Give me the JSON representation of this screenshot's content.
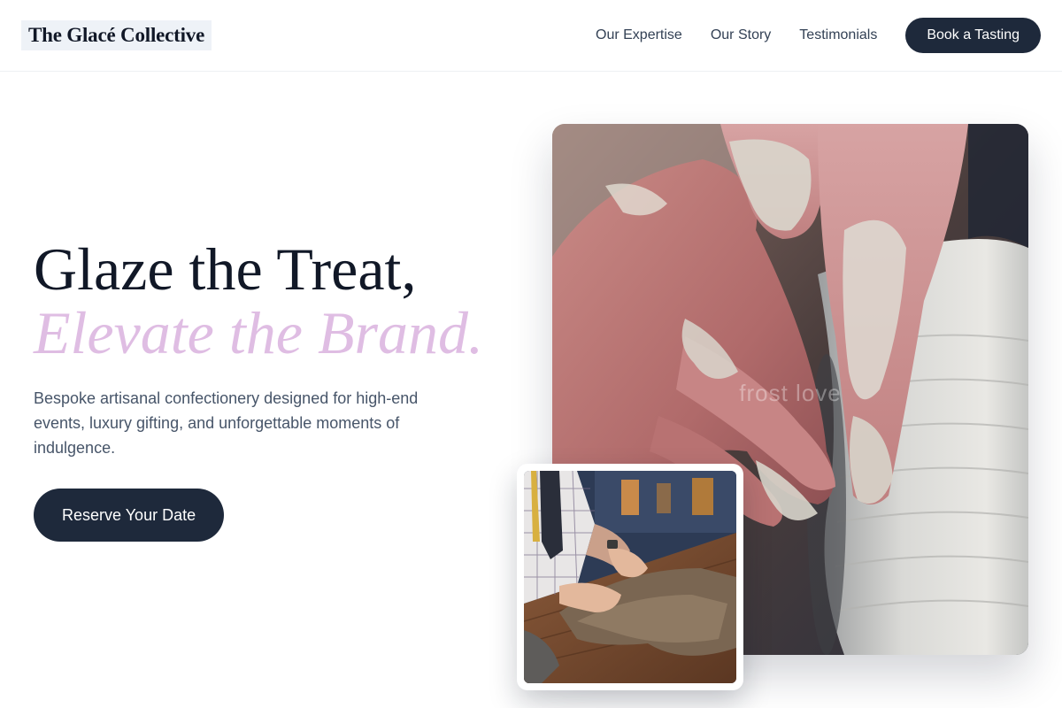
{
  "header": {
    "logo": "The Glacé Collective",
    "nav": {
      "expertise": "Our Expertise",
      "story": "Our Story",
      "testimonials": "Testimonials",
      "cta": "Book a Tasting"
    }
  },
  "hero": {
    "headline_line1": "Glaze the Treat,",
    "headline_line2": "Elevate the Brand.",
    "subtext": "Bespoke artisanal confectionery designed for high-end events, luxury gifting, and unforgettable moments of indulgence.",
    "cta": "Reserve Your Date"
  },
  "images": {
    "main_watermark": "frost love"
  },
  "colors": {
    "brand_dark": "#1e293b",
    "accent_lilac": "#dfbde3",
    "body_text": "#475569"
  }
}
